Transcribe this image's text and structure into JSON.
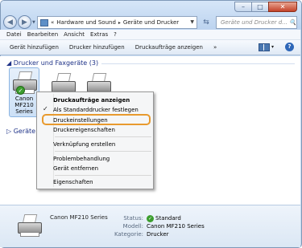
{
  "window": {
    "minimize": "–",
    "maximize": "□",
    "close": "✕"
  },
  "nav": {
    "back": "◀",
    "forward": "▶",
    "dropdown": "▼",
    "breadcrumb_overflow": "«",
    "breadcrumb": [
      "Hardware und Sound",
      "Geräte und Drucker"
    ],
    "breadcrumb_sep": "▸",
    "address_dropdown": "▼",
    "refresh": "⇆",
    "search_placeholder": "Geräte und Drucker d... 🔍"
  },
  "menu": {
    "items": [
      "Datei",
      "Bearbeiten",
      "Ansicht",
      "Extras",
      "?"
    ]
  },
  "toolbar": {
    "items": [
      "Gerät hinzufügen",
      "Drucker hinzufügen",
      "Druckaufträge anzeigen",
      "»"
    ],
    "view_dropdown": "▾",
    "help": "?"
  },
  "groups": {
    "printers": "◢ Drucker und Faxgeräte (3)",
    "devices": "▷ Geräte"
  },
  "selected_device": {
    "label": "Canon MF210 Series",
    "default_check": "✓"
  },
  "context_menu": {
    "items": [
      "Druckaufträge anzeigen",
      "Als Standarddrucker festlegen",
      "Druckeinstellungen",
      "Druckereigenschaften",
      "Verknüpfung erstellen",
      "Problembehandlung",
      "Gerät entfernen",
      "Eigenschaften"
    ],
    "check": "✓"
  },
  "details": {
    "name": "Canon MF210 Series",
    "labels": [
      "Status:",
      "Modell:",
      "Kategorie:"
    ],
    "status": "Standard",
    "model": "Canon MF210 Series",
    "category": "Drucker",
    "status_check": "✓"
  }
}
